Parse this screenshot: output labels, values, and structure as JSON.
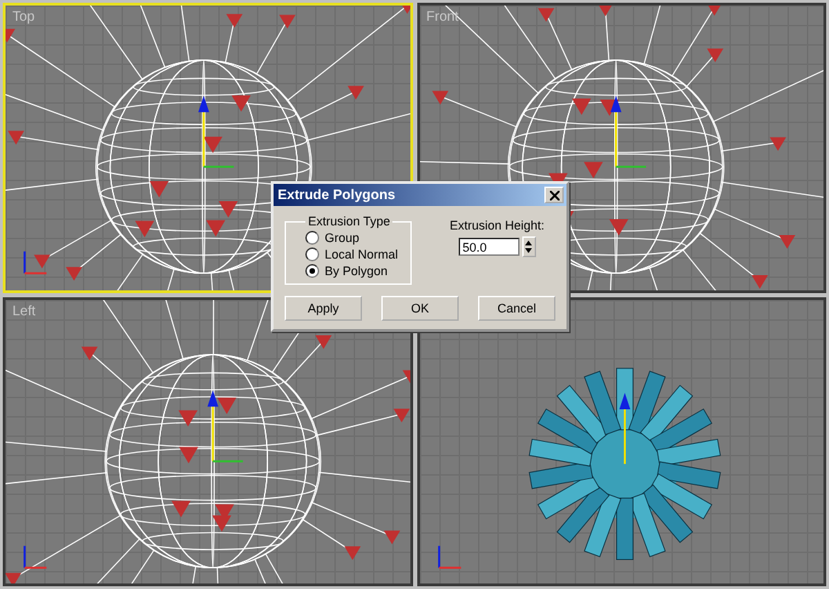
{
  "viewports": [
    {
      "label": "Top",
      "kind": "wireframe",
      "active": true
    },
    {
      "label": "Front",
      "kind": "wireframe",
      "active": false
    },
    {
      "label": "Left",
      "kind": "wireframe",
      "active": false
    },
    {
      "kind": "shaded",
      "active": false
    }
  ],
  "dialog": {
    "title": "Extrude Polygons",
    "group_title": "Extrusion Type",
    "options": [
      {
        "label": "Group",
        "selected": false
      },
      {
        "label": "Local Normal",
        "selected": false
      },
      {
        "label": "By Polygon",
        "selected": true
      }
    ],
    "height_label": "Extrusion Height:",
    "height_value": "50.0",
    "buttons": [
      "Apply",
      "OK",
      "Cancel"
    ]
  }
}
